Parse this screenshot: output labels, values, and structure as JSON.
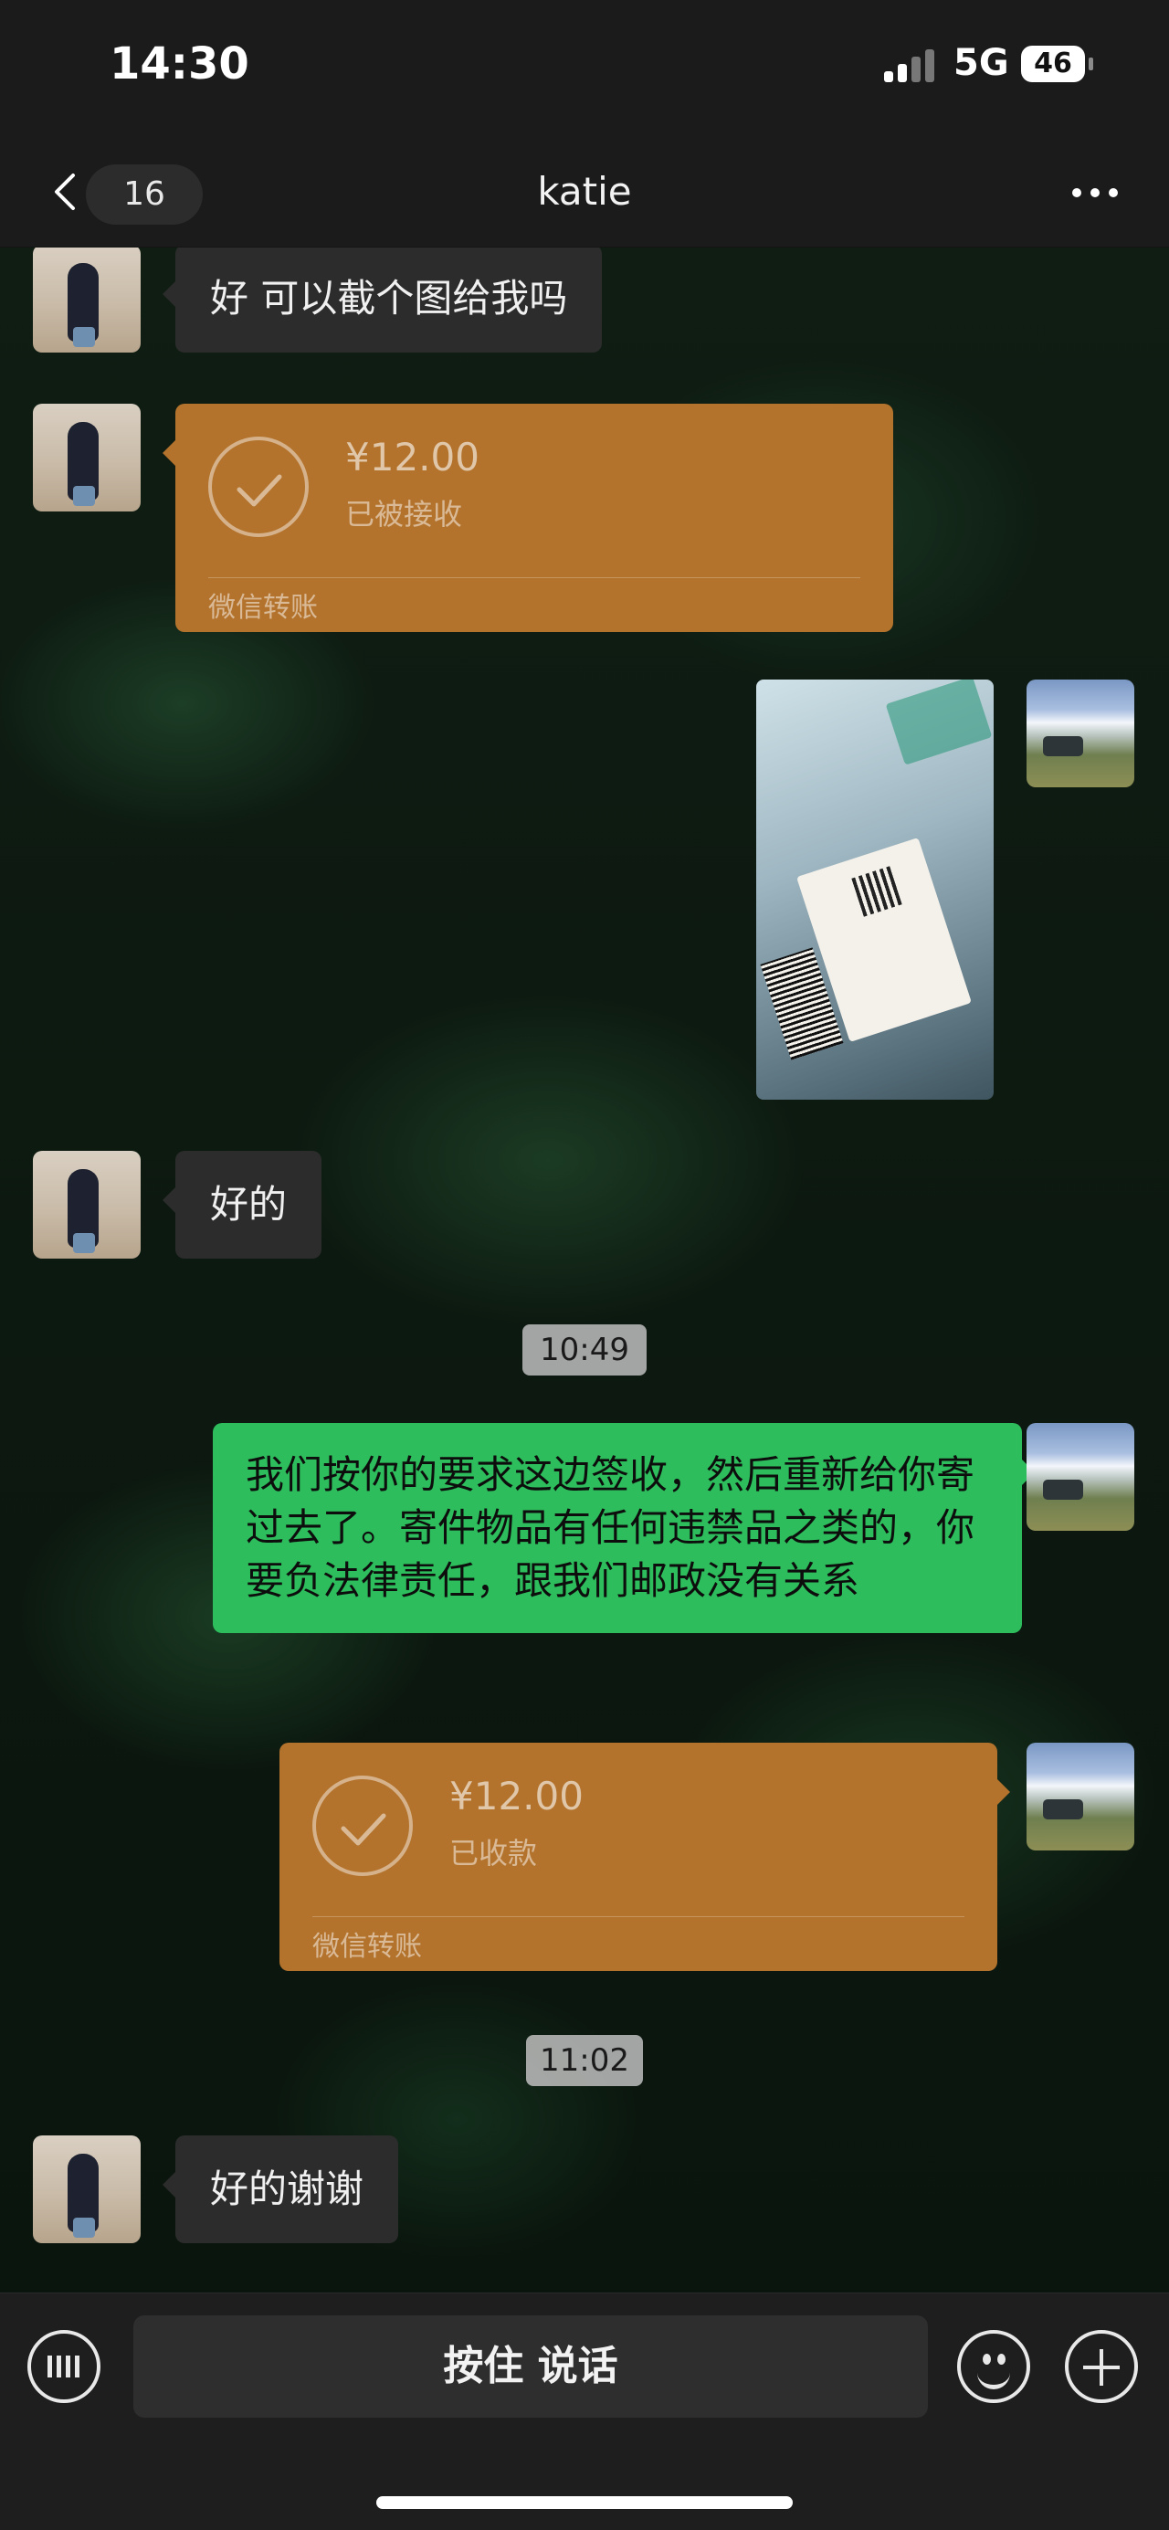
{
  "status_bar": {
    "time": "14:30",
    "network": "5G",
    "battery": "46"
  },
  "nav": {
    "unread_count": "16",
    "title": "katie"
  },
  "messages": [
    {
      "sender": "friend",
      "type": "text",
      "text": "好 可以截个图给我吗"
    },
    {
      "sender": "friend",
      "type": "transfer",
      "amount": "¥12.00",
      "status": "已被接收",
      "label": "微信转账"
    },
    {
      "sender": "me",
      "type": "image",
      "description": "package-photo"
    },
    {
      "sender": "friend",
      "type": "text",
      "text": "好的"
    },
    {
      "type": "timestamp",
      "text": "10:49"
    },
    {
      "sender": "me",
      "type": "text",
      "text": "我们按你的要求这边签收，然后重新给你寄过去了。寄件物品有任何违禁品之类的，你要负法律责任，跟我们邮政没有关系"
    },
    {
      "sender": "me",
      "type": "transfer",
      "amount": "¥12.00",
      "status": "已收款",
      "label": "微信转账"
    },
    {
      "type": "timestamp",
      "text": "11:02"
    },
    {
      "sender": "friend",
      "type": "text",
      "text": "好的谢谢"
    }
  ],
  "input_bar": {
    "voice_label": "按住 说话"
  },
  "colors": {
    "green_bubble": "#2dbd5c",
    "gray_bubble": "#2c2c2c",
    "transfer": "#b3732c",
    "bar": "#1b1b1b"
  }
}
